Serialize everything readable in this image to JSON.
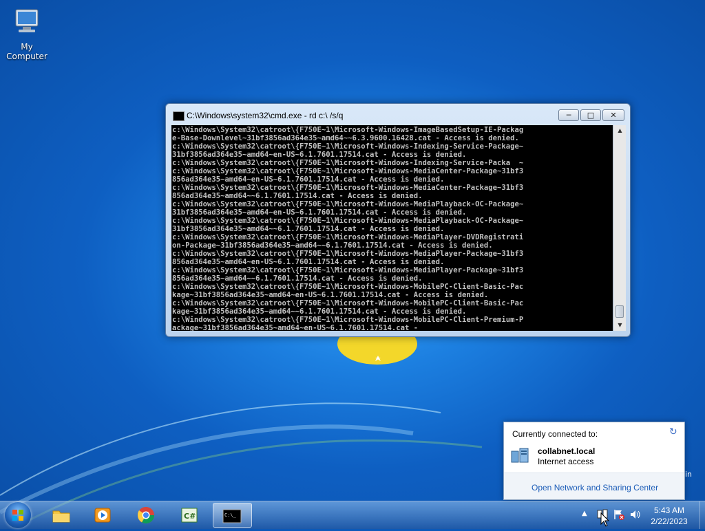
{
  "desktop": {
    "icons": [
      {
        "label": "My Computer",
        "icon": "computer-icon"
      }
    ],
    "stray_text": "in"
  },
  "cmd_window": {
    "title": "C:\\Windows\\system32\\cmd.exe - rd  c:\\ /s/q",
    "buttons": {
      "minimize": "minimize-icon",
      "maximize": "maximize-icon",
      "close": "close-icon"
    },
    "lines": [
      "c:\\Windows\\System32\\catroot\\{F750E~1\\Microsoft-Windows-ImageBasedSetup-IE-Packag",
      "e-Base-Downlevel~31bf3856ad364e35~amd64~~6.3.9600.16428.cat - Access is denied.",
      "c:\\Windows\\System32\\catroot\\{F750E~1\\Microsoft-Windows-Indexing-Service-Package~",
      "31bf3856ad364e35~amd64~en-US~6.1.7601.17514.cat - Access is denied.",
      "c:\\Windows\\System32\\catroot\\{F750E~1\\Microsoft-Windows-Indexing-Service-Packa  ~",
      "c:\\Windows\\System32\\catroot\\{F750E~1\\Microsoft-Windows-MediaCenter-Package~31bf3",
      "856ad364e35~amd64~en-US~6.1.7601.17514.cat - Access is denied.",
      "c:\\Windows\\System32\\catroot\\{F750E~1\\Microsoft-Windows-MediaCenter-Package~31bf3",
      "856ad364e35~amd64~~6.1.7601.17514.cat - Access is denied.",
      "c:\\Windows\\System32\\catroot\\{F750E~1\\Microsoft-Windows-MediaPlayback-OC-Package~",
      "31bf3856ad364e35~amd64~en-US~6.1.7601.17514.cat - Access is denied.",
      "c:\\Windows\\System32\\catroot\\{F750E~1\\Microsoft-Windows-MediaPlayback-OC-Package~",
      "31bf3856ad364e35~amd64~~6.1.7601.17514.cat - Access is denied.",
      "c:\\Windows\\System32\\catroot\\{F750E~1\\Microsoft-Windows-MediaPlayer-DVDRegistrati",
      "on-Package~31bf3856ad364e35~amd64~~6.1.7601.17514.cat - Access is denied.",
      "c:\\Windows\\System32\\catroot\\{F750E~1\\Microsoft-Windows-MediaPlayer-Package~31bf3",
      "856ad364e35~amd64~en-US~6.1.7601.17514.cat - Access is denied.",
      "c:\\Windows\\System32\\catroot\\{F750E~1\\Microsoft-Windows-MediaPlayer-Package~31bf3",
      "856ad364e35~amd64~~6.1.7601.17514.cat - Access is denied.",
      "c:\\Windows\\System32\\catroot\\{F750E~1\\Microsoft-Windows-MobilePC-Client-Basic-Pac",
      "kage~31bf3856ad364e35~amd64~en-US~6.1.7601.17514.cat - Access is denied.",
      "c:\\Windows\\System32\\catroot\\{F750E~1\\Microsoft-Windows-MobilePC-Client-Basic-Pac",
      "kage~31bf3856ad364e35~amd64~~6.1.7601.17514.cat - Access is denied.",
      "c:\\Windows\\System32\\catroot\\{F750E~1\\Microsoft-Windows-MobilePC-Client-Premium-P",
      "ackage~31bf3856ad364e35~amd64~en-US~6.1.7601.17514.cat -"
    ]
  },
  "network_popup": {
    "header": "Currently connected to:",
    "network_name": "collabnet.local",
    "network_status": "Internet access",
    "link": "Open Network and Sharing Center"
  },
  "taskbar": {
    "apps": [
      {
        "name": "explorer",
        "icon": "folder-icon"
      },
      {
        "name": "media-player",
        "icon": "media-player-icon"
      },
      {
        "name": "chrome",
        "icon": "chrome-icon"
      },
      {
        "name": "csharp",
        "icon": "csharp-icon",
        "label": "C#"
      },
      {
        "name": "cmd",
        "icon": "cmd-icon",
        "label": "C:\\_"
      }
    ],
    "clock": {
      "time": "5:43 AM",
      "date": "2/22/2023"
    }
  }
}
